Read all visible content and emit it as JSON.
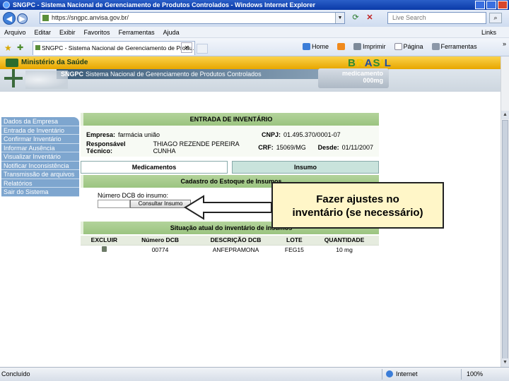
{
  "window": {
    "title": "SNGPC - Sistema Nacional de Gerenciamento de Produtos Controlados - Windows Internet Explorer"
  },
  "address": {
    "url": "https://sngpc.anvisa.gov.br/"
  },
  "search": {
    "placeholder": "Live Search"
  },
  "menu": {
    "items": [
      "Arquivo",
      "Editar",
      "Exibir",
      "Favoritos",
      "Ferramentas",
      "Ajuda"
    ],
    "links_label": "Links"
  },
  "tab": {
    "title": "SNGPC - Sistema Nacional de Gerenciamento de Produ..."
  },
  "commands": {
    "home": "Home",
    "print": "Imprimir",
    "page": "Página",
    "tools": "Ferramentas"
  },
  "site": {
    "ministry": "Ministério da Saúde",
    "brasil": "BRASIL",
    "sngpc_short": "SNGPC",
    "sngpc_full": "Sistema Nacional de Gerenciamento de Produtos Controlados",
    "med_line1": "medicamento",
    "med_line2": "000mg"
  },
  "sidebar": {
    "items": [
      "Dados da Empresa",
      "Entrada de Inventário",
      "Confirmar Inventário",
      "Informar Ausência",
      "Visualizar Inventário",
      "Notificar Inconsistência",
      "Transmissão de arquivos",
      "Relatórios",
      "Sair do Sistema"
    ]
  },
  "content": {
    "section_title": "ENTRADA DE INVENTÁRIO",
    "empresa_label": "Empresa:",
    "empresa_value": "farmácia união",
    "cnpj_label": "CNPJ:",
    "cnpj_value": "01.495.370/0001-07",
    "resp_label": "Responsável Técnico:",
    "resp_value": "THIAGO REZENDE PEREIRA CUNHA",
    "crf_label": "CRF:",
    "crf_value": "15069/MG",
    "desde_label": "Desde:",
    "desde_value": "01/11/2007",
    "tab_medicamentos": "Medicamentos",
    "tab_insumo": "Insumo",
    "cadastro_title": "Cadastro do Estoque de Insumos",
    "dcb_label": "Número DCB do insumo:",
    "dcb_value": "",
    "consultar_label": "Consultar Insumo",
    "situacao_title": "Situação atual do inventário de insumos",
    "table": {
      "headers": [
        "EXCLUIR",
        "Número DCB",
        "DESCRIÇÃO DCB",
        "LOTE",
        "QUANTIDADE"
      ],
      "rows": [
        [
          "",
          "00774",
          "ANFEPRAMONA",
          "FEG15",
          "10 mg"
        ]
      ]
    }
  },
  "callout": {
    "line1": "Fazer ajustes no",
    "line2": "inventário (se necessário)"
  },
  "status": {
    "left": "Concluído",
    "zone": "Internet",
    "zoom": "100%"
  }
}
